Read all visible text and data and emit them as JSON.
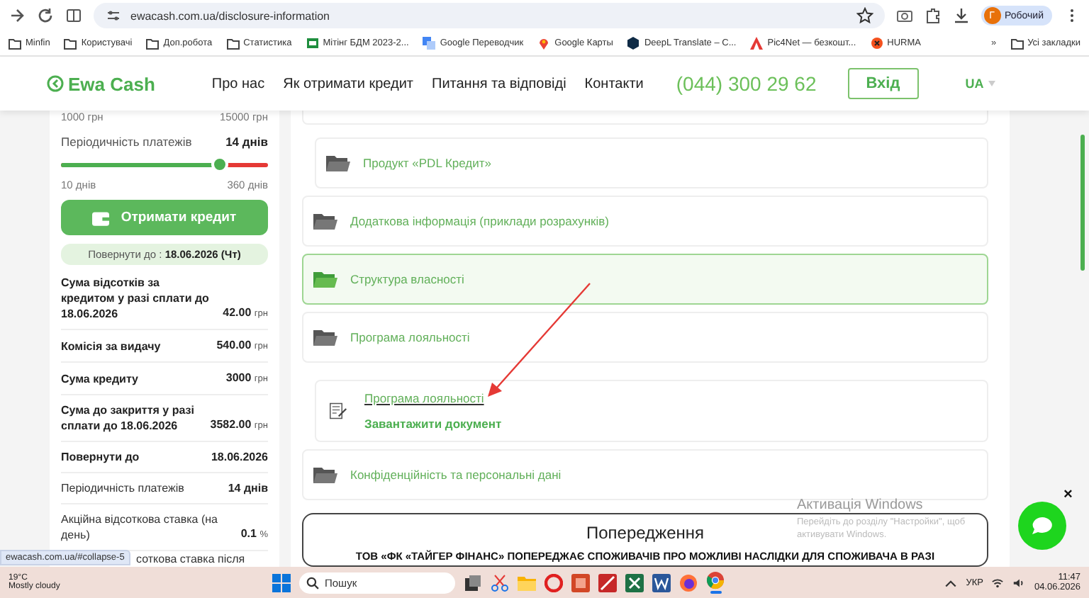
{
  "browser": {
    "url": "ewacash.com.ua/disclosure-information",
    "profile": {
      "initial": "Г",
      "name": "Робочий"
    }
  },
  "bookmarks": [
    {
      "kind": "folder",
      "label": "Minfin"
    },
    {
      "kind": "folder",
      "label": "Користувачі"
    },
    {
      "kind": "folder",
      "label": "Доп.робота"
    },
    {
      "kind": "folder",
      "label": "Статистика"
    },
    {
      "kind": "sheet",
      "label": "Мітінг БДМ 2023-2..."
    },
    {
      "kind": "translate",
      "label": "Google Переводчик"
    },
    {
      "kind": "pin",
      "label": "Google Карты"
    },
    {
      "kind": "hexagon",
      "label": "DeepL Translate – C..."
    },
    {
      "kind": "triangle",
      "label": "Pic4Net — безкошт..."
    },
    {
      "kind": "dot",
      "label": "HURMA"
    }
  ],
  "bookmarks_more": "»",
  "all_bookmarks": "Усі закладки",
  "header": {
    "logo": "Ewa Cash",
    "nav": [
      "Про нас",
      "Як отримати кредит",
      "Питання та відповіді",
      "Контакти"
    ],
    "phone": "(044) 300 29 62",
    "login": "Вхід",
    "language": {
      "label": "UA",
      "selected": true
    }
  },
  "calculator": {
    "amount_min": "1000 грн",
    "amount_max": "15000 грн",
    "period_label": "Періодичність платежів",
    "period_value": "14 днів",
    "period_slider": {
      "level": 0.77
    },
    "period_min": "10 днів",
    "period_max": "360 днів",
    "cta": "Отримати кредит",
    "return_date": "Повернути до : **18.06.2026 (Чт)**",
    "rows": [
      {
        "label": "Сума відсотків за кредитом у разі сплати до 18.06.2026",
        "value": "42.00",
        "unit": "грн",
        "bold": true
      },
      {
        "label": "Комісія за видачу",
        "value": "540.00",
        "unit": "грн",
        "bold": true
      },
      {
        "label": "Сума кредиту",
        "value": "3000",
        "unit": "грн",
        "bold": true
      },
      {
        "label": "Сума до закриття у разі сплати до 18.06.2026",
        "value": "3582.00",
        "unit": "грн",
        "bold": true
      },
      {
        "label": "Повернути до",
        "value": "18.06.2026",
        "bold": true
      },
      {
        "label": "Періодичність платежів",
        "value": "14 днів",
        "bold": false
      },
      {
        "label": "Акційна відсоткова ставка (на день)",
        "value": "0.1",
        "unit": "%",
        "bold": false
      },
      {
        "label": "соткова ставка після",
        "bold": false
      }
    ]
  },
  "sections": [
    {
      "kind": "group",
      "children": [
        {
          "kind": "folder",
          "label": "Продукт «PDL Кредит»",
          "selected": false
        }
      ]
    },
    {
      "kind": "folder",
      "label": "Додаткова інформація (приклади розрахунків)",
      "selected": false
    },
    {
      "kind": "folder",
      "label": "Структура власності",
      "selected": true
    },
    {
      "kind": "folder",
      "label": "Програма лояльності",
      "selected": false,
      "children": [
        {
          "kind": "document",
          "link": "Програма лояльності",
          "download": "Завантажити документ"
        }
      ]
    },
    {
      "kind": "folder",
      "label": "Конфіденційність та персональні дані",
      "selected": false
    }
  ],
  "warning": {
    "title": "Попередження",
    "text": "ТОВ «ФК «ТАЙГЕР ФІНАНС» ПОПЕРЕДЖАЄ СПОЖИВАЧІВ ПРО МОЖЛИВІ НАСЛІДКИ ДЛЯ СПОЖИВАЧА В РАЗІ"
  },
  "status_url": "ewacash.com.ua/#collapse-5",
  "activation": {
    "title": "Активація Windows",
    "text": "Перейдіть до розділу \"Настройки\", щоб активувати Windows."
  },
  "chat_close": "×",
  "taskbar": {
    "weather": {
      "temp": "19°C",
      "text": "Mostly cloudy"
    },
    "search": "Пошук",
    "apps": [
      {
        "kind": "taskview"
      },
      {
        "kind": "scissors"
      },
      {
        "kind": "files"
      },
      {
        "kind": "ring"
      },
      {
        "kind": "slides"
      },
      {
        "kind": "paint"
      },
      {
        "kind": "sheets"
      },
      {
        "kind": "docs"
      },
      {
        "kind": "fox"
      },
      {
        "kind": "chrome",
        "active": true
      }
    ],
    "language": "УКР",
    "time": "11:47",
    "date": "04.06.2026"
  }
}
